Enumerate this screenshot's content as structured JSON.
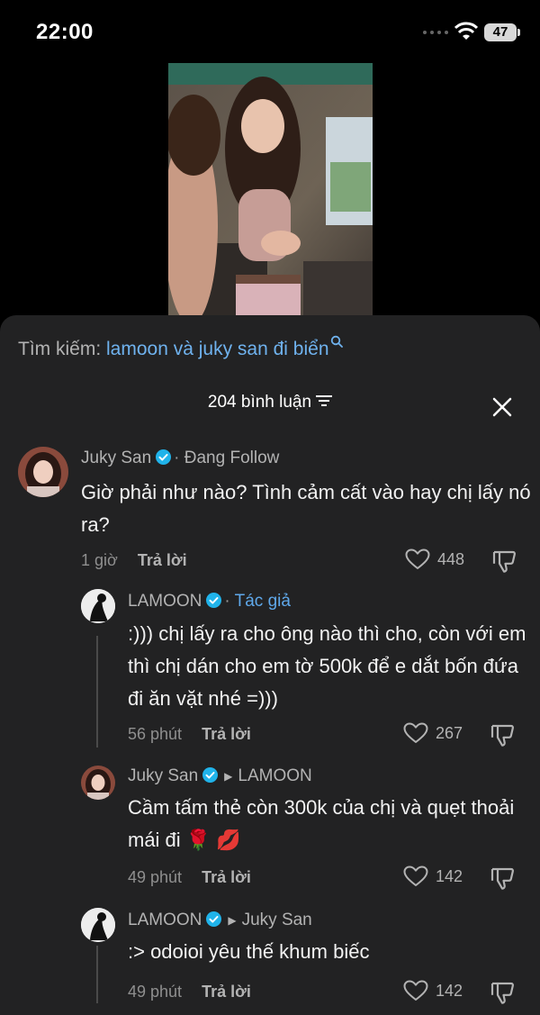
{
  "status_bar": {
    "time": "22:00",
    "battery": "47"
  },
  "search": {
    "prefix": "Tìm kiếm:",
    "query": "lamoon và juky san đi biển"
  },
  "comments_header": {
    "count_label": "204 bình luận"
  },
  "comments": [
    {
      "author": "Juky San",
      "separator": "·",
      "tag": "Đang Follow",
      "text": "Giờ phải như nào? Tình cảm cất vào hay chị lấy nó ra?",
      "time": "1 giờ",
      "reply_label": "Trả lời",
      "likes": "448"
    },
    {
      "author": "LAMOON",
      "separator": "·",
      "tag": "Tác giả",
      "text": ":))) chị lấy ra cho ông nào thì cho, còn với em thì chị dán cho em tờ 500k để e dắt bốn đứa đi ăn vặt nhé =)))",
      "time": "56 phút",
      "reply_label": "Trả lời",
      "likes": "267"
    },
    {
      "author": "Juky San",
      "reply_to": "LAMOON",
      "text": "Cầm tấm thẻ còn 300k của chị và quẹt thoải mái đi 🌹 💋",
      "time": "49 phút",
      "reply_label": "Trả lời",
      "likes": "142"
    },
    {
      "author": "LAMOON",
      "reply_to": "Juky San",
      "text": ":> odoioi yêu thế khum biếc",
      "time": "49 phút",
      "reply_label": "Trả lời",
      "likes": "142"
    }
  ],
  "colors": {
    "accent": "#5fa8ea",
    "verified": "#20b3ea",
    "sheet_bg": "#222223"
  }
}
